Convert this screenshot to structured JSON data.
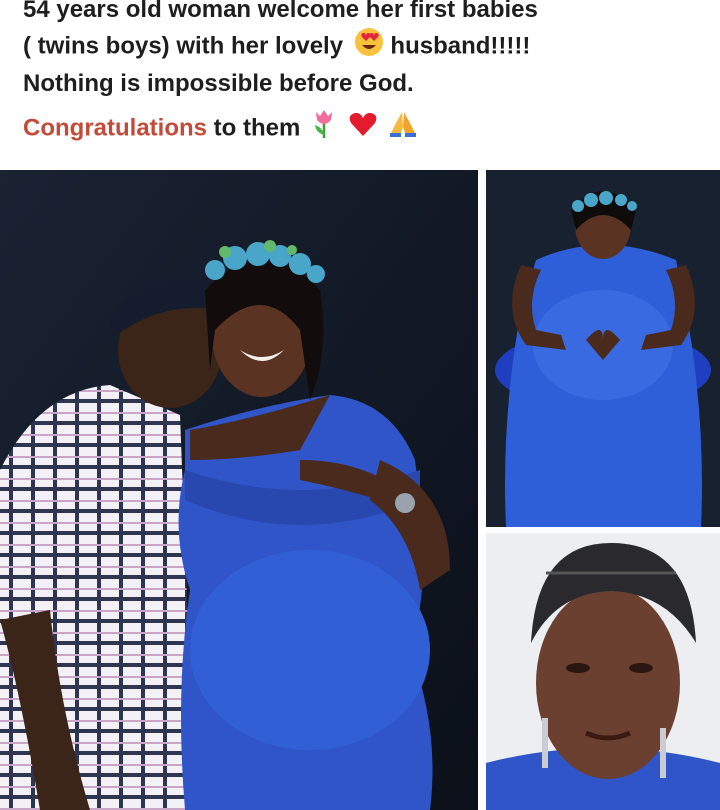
{
  "post": {
    "line1": "54 years old woman  welcome her first babies",
    "line2_a": "( twins boys) with her lovely",
    "line2_b": "husband!!!!!",
    "line3": "Nothing is impossible before God.",
    "line4_highlight": "Congratulations",
    "line4_rest": "to them",
    "highlight_color": "#c44a3a",
    "emojis": [
      "heart-eyes-emoji",
      "tulip-emoji",
      "red-heart-emoji",
      "folded-hands-emoji"
    ]
  },
  "photos": [
    {
      "name": "couple-photo",
      "subject": "man kissing pregnant woman in blue dress"
    },
    {
      "name": "maternity-photo",
      "subject": "woman in blue dress forming heart on belly"
    },
    {
      "name": "portrait-photo",
      "subject": "close-up portrait of woman with head wrap"
    }
  ],
  "colors": {
    "dress_blue": "#2f55c8",
    "background_dark": "#0f1624"
  }
}
